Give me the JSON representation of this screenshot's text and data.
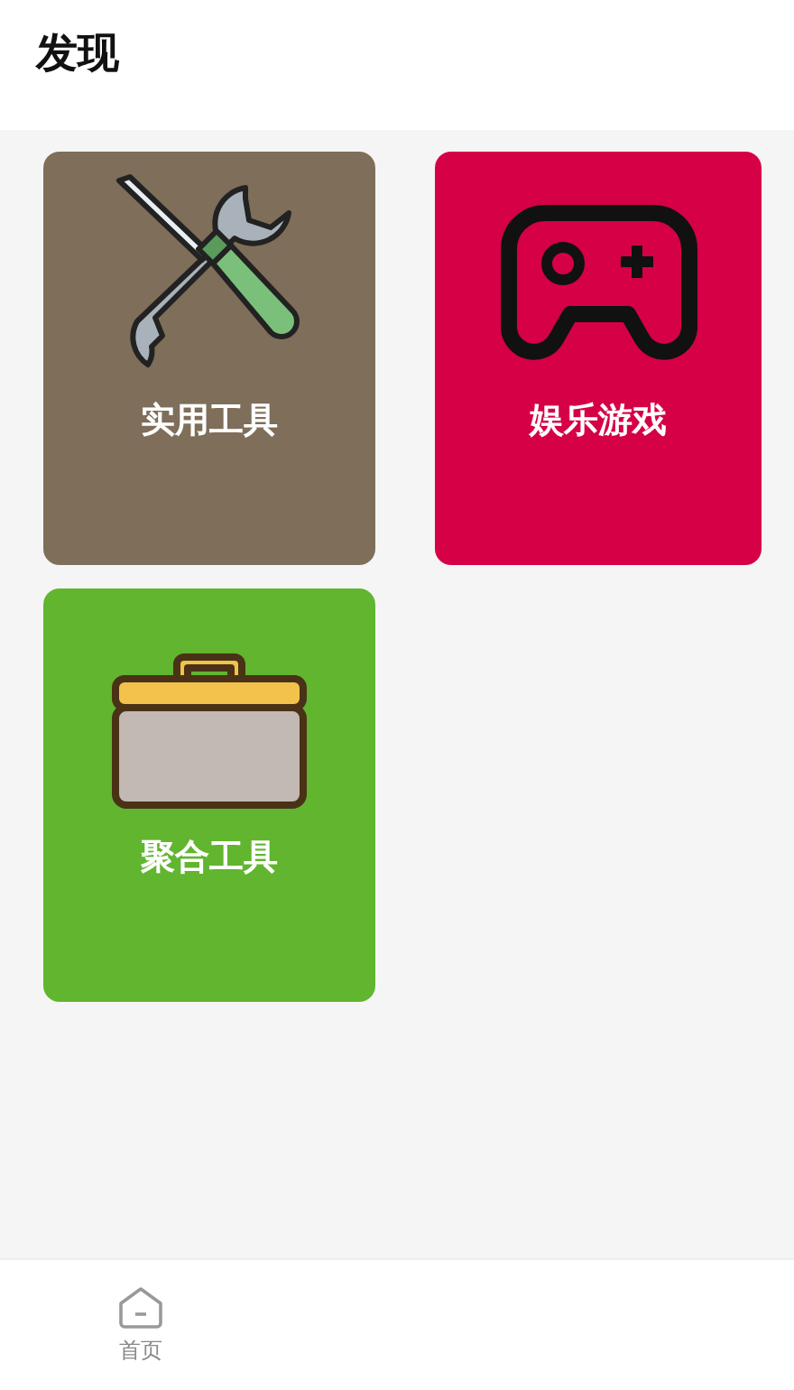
{
  "header": {
    "title": "发现"
  },
  "cards": [
    {
      "label": "实用工具",
      "color": "#7e6e5a",
      "kind": "tools"
    },
    {
      "label": "娱乐游戏",
      "color": "#d50046",
      "kind": "gamepad"
    },
    {
      "label": "聚合工具",
      "color": "#62b52f",
      "kind": "toolbox"
    }
  ],
  "bottom_nav": [
    {
      "label": "首页",
      "kind": "home"
    }
  ]
}
